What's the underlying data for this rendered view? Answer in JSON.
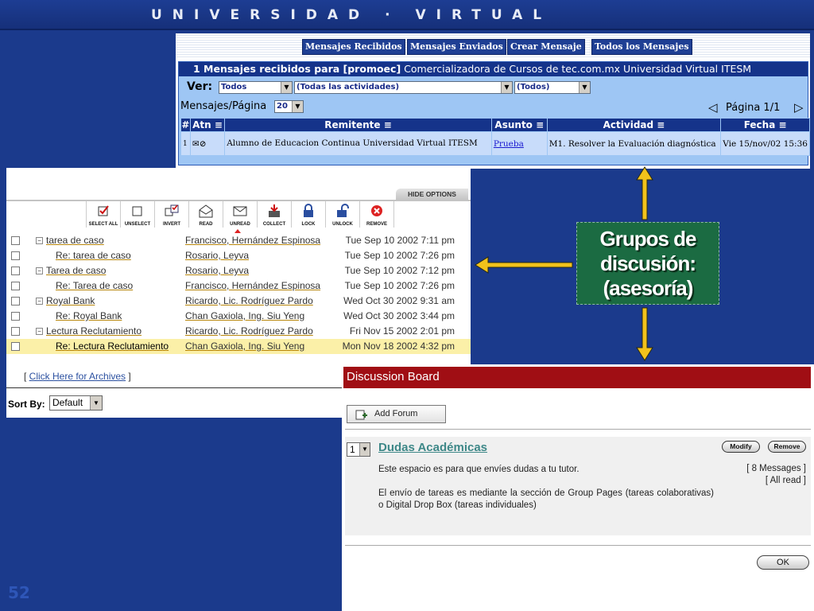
{
  "banner": {
    "title": "UNIVERSIDAD · VIRTUAL"
  },
  "slide_number": "52",
  "mensajes": {
    "nav": [
      "Mensajes Recibidos",
      "Mensajes Enviados",
      "Crear Mensaje",
      "Todos los Mensajes"
    ],
    "header_bold": "1  Mensajes recibidos para [promoec]",
    "header_rest": " Comercializadora de Cursos de tec.com.mx Universidad Virtual ITESM",
    "ver_label": "Ver:",
    "filter1": "Todos",
    "filter2": "(Todas las actividades)",
    "filter3": "(Todos)",
    "per_page_label": "Mensajes/Página",
    "per_page_value": "20",
    "pagina": "Página 1/1",
    "columns": [
      "#",
      "Atn",
      "Remitente",
      "Asunto",
      "Actividad",
      "Fecha"
    ],
    "rows": [
      {
        "num": "1",
        "remitente": "Alumno de Educacion Continua Universidad Virtual ITESM",
        "asunto": "Prueba",
        "actividad": "M1. Resolver la Evaluación diagnóstica",
        "fecha": "Vie 15/nov/02 15:36"
      }
    ]
  },
  "forum": {
    "hide_options": "HIDE OPTIONS",
    "toolbar": [
      "SELECT ALL",
      "UNSELECT",
      "INVERT",
      "READ",
      "UNREAD",
      "COLLECT",
      "LOCK",
      "UNLOCK",
      "REMOVE"
    ],
    "threads": [
      {
        "subject": "tarea de caso",
        "author": "Francisco, Hernández Espinosa",
        "date": "Tue Sep 10 2002 7:11 pm"
      },
      {
        "subject": "Re: tarea de caso",
        "author": "Rosario, Leyva",
        "date": "Tue Sep 10 2002 7:26 pm"
      },
      {
        "subject": "Tarea de caso",
        "author": "Rosario, Leyva",
        "date": "Tue Sep 10 2002 7:12 pm"
      },
      {
        "subject": "Re: Tarea de caso",
        "author": "Francisco, Hernández Espinosa",
        "date": "Tue Sep 10 2002 7:26 pm"
      },
      {
        "subject": "Royal Bank",
        "author": "Ricardo, Lic. Rodríguez Pardo",
        "date": "Wed Oct 30 2002 9:31 am"
      },
      {
        "subject": "Re: Royal Bank",
        "author": "Chan Gaxiola, Ing. Siu Yeng",
        "date": "Wed Oct 30 2002 3:44 pm"
      },
      {
        "subject": "Lectura Reclutamiento",
        "author": "Ricardo, Lic. Rodríguez Pardo",
        "date": "Fri Nov 15 2002 2:01 pm"
      },
      {
        "subject": "Re: Lectura Reclutamiento",
        "author": "Chan Gaxiola, Ing. Siu Yeng",
        "date": "Mon Nov 18 2002 4:32 pm"
      }
    ],
    "archives_pre": "[ ",
    "archives_link": "Click Here for Archives",
    "archives_post": " ]",
    "sort_label": "Sort By:",
    "sort_value": "Default"
  },
  "callout": {
    "line1": "Grupos de",
    "line2": "discusión:",
    "line3": "(asesoría)"
  },
  "board": {
    "title": "Discussion Board",
    "add_forum": "Add Forum",
    "forum_num": "1",
    "forum_name": "Dudas Académicas",
    "modify": "Modify",
    "remove": "Remove",
    "desc1": "Este espacio es para que envíes dudas a tu tutor.",
    "desc2": "El envío de tareas es mediante la sección de Group Pages (tareas colaborativas) o Digital Drop Box (tareas individuales)",
    "messages": "[ 8 Messages ]",
    "all_read": "[ All read ]",
    "ok": "OK"
  },
  "colors": {
    "banner": "#1b3a8c",
    "callout": "#1b6b42",
    "board_title": "#a00e14",
    "arrow": "#f2c21b"
  }
}
